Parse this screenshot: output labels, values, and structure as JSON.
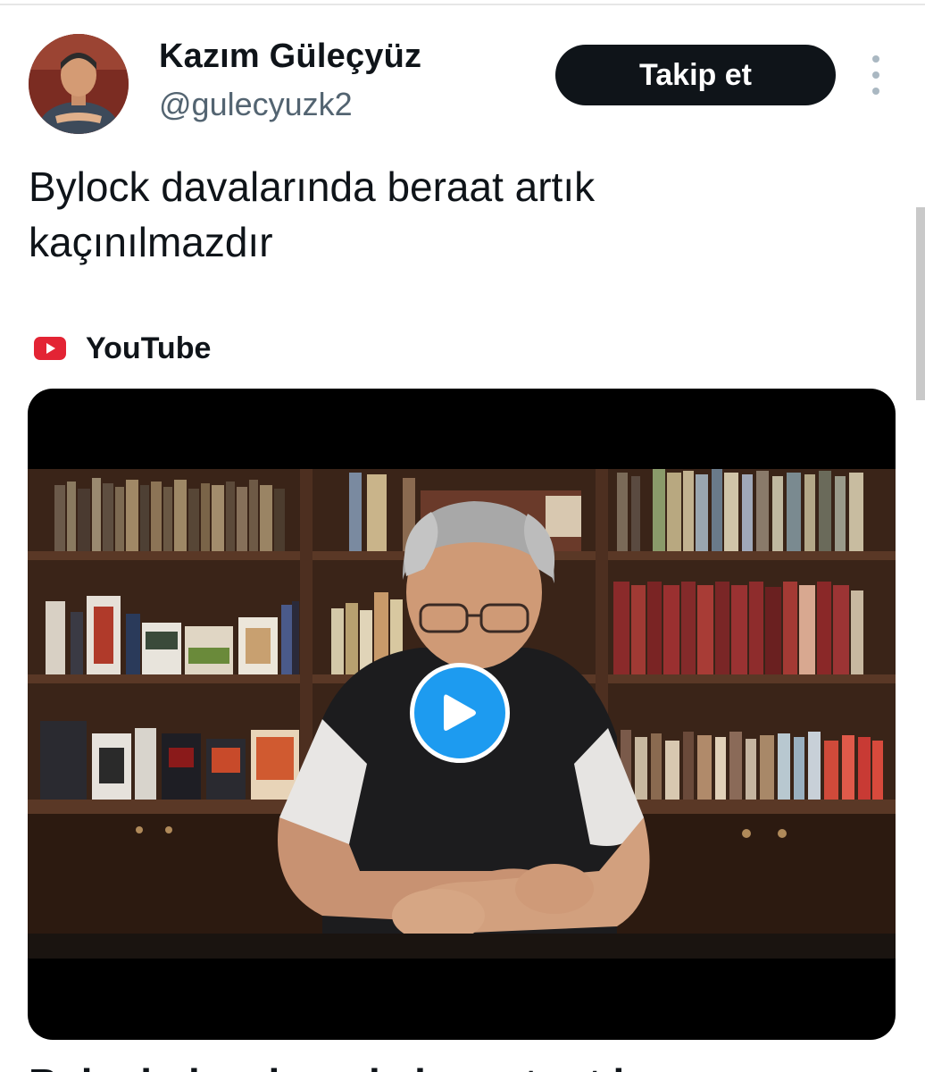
{
  "tweet": {
    "author": {
      "name": "Kazım Güleçyüz",
      "handle": "@gulecyuzk2"
    },
    "follow_label": "Takip et",
    "more_icon": "more-vertical-icon",
    "text": "Bylock davalarında beraat artık kaçınılmazdır",
    "card": {
      "source_icon": "youtube-icon",
      "source": "YouTube",
      "play_icon": "play-icon",
      "title_partial": "Bylock davalarında beraat artık"
    }
  },
  "colors": {
    "text_primary": "#0f1419",
    "text_secondary": "#536471",
    "follow_bg": "#0f1419",
    "play_accent": "#1d9bf0",
    "youtube_red": "#e32434"
  }
}
